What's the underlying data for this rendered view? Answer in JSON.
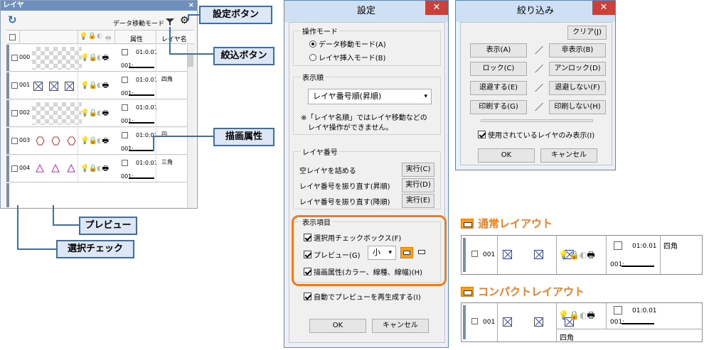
{
  "layer_panel": {
    "title": "レイヤ",
    "close": "×",
    "mode_label": "データ移動モード",
    "headers": {
      "attr": "属性",
      "name": "レイヤ名"
    },
    "rows": [
      {
        "num": "000",
        "time": "01:0.01",
        "l1": "001:",
        "name": ""
      },
      {
        "num": "001",
        "time": "01:0.01",
        "l1": "001:",
        "name": "四角"
      },
      {
        "num": "002",
        "time": "01:0.01",
        "l1": "001:",
        "name": ""
      },
      {
        "num": "003",
        "time": "01:0.01",
        "l1": "001:",
        "name": "円"
      },
      {
        "num": "004",
        "time": "01:0.01",
        "l1": "001:",
        "name": "三角"
      }
    ]
  },
  "callouts": {
    "settings": "設定ボタン",
    "filter": "絞込ボタン",
    "draw_attr": "描画属性",
    "preview": "プレビュー",
    "select_check": "選択チェック"
  },
  "settings_dialog": {
    "title": "設定",
    "op_mode": "操作モード",
    "radio1": "データ移動モード(A)",
    "radio2": "レイヤ挿入モード(B)",
    "order_group": "表示順",
    "order_value": "レイヤ番号順(昇順)",
    "note1": "※「レイヤ名順」ではレイヤ移動などの",
    "note2": "レイヤ操作ができません。",
    "num_group": "レイヤ番号",
    "act1": "空レイヤを詰める",
    "act2": "レイヤ番号を振り直す(昇順)",
    "act3": "レイヤ番号を振り直す(降順)",
    "btn_c": "実行(C)",
    "btn_d": "実行(D)",
    "btn_e": "実行(E)",
    "disp_group": "表示項目",
    "chk1": "選択用チェックボックス(F)",
    "chk2": "プレビュー(G)",
    "size_value": "小",
    "chk3": "描画属性(カラー、線種、線幅)(H)",
    "chk4": "自動でプレビューを再生成する(I)",
    "ok": "OK",
    "cancel": "キャンセル"
  },
  "filter_dialog": {
    "title": "絞り込み",
    "clear": "クリア(J)",
    "pairs": [
      [
        "表示(A)",
        "非表示(B)"
      ],
      [
        "ロック(C)",
        "アンロック(D)"
      ],
      [
        "退避する(E)",
        "退避しない(F)"
      ],
      [
        "印刷する(G)",
        "印刷しない(H)"
      ]
    ],
    "only_used": "使用されているレイヤのみ表示(I)",
    "ok": "OK",
    "cancel": "キャンセル"
  },
  "layouts": {
    "normal_title": "通常レイアウト",
    "compact_title": "コンパクトレイアウト",
    "num": "001",
    "time": "01:0.01",
    "l1": "001:",
    "name": "四角"
  },
  "colors": {
    "accent": "#ef7d1f",
    "callout_border": "#3e6ea9",
    "title_bar": "#6f90bd"
  }
}
